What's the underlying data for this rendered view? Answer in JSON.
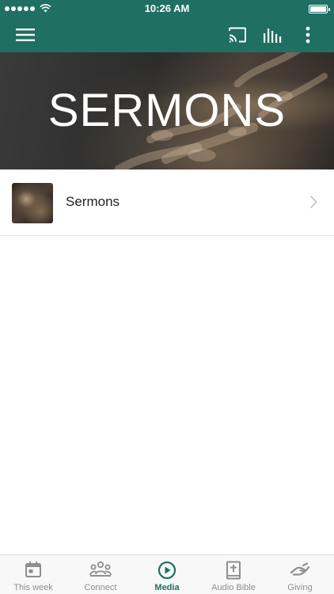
{
  "colors": {
    "brand": "#1f6f63",
    "tab_inactive": "#8e8e8e",
    "text": "#222222"
  },
  "status_bar": {
    "time": "10:26 AM",
    "signal_icon": "signal-dots-icon",
    "wifi_icon": "wifi-icon",
    "battery_icon": "battery-icon"
  },
  "app_bar": {
    "menu_icon": "hamburger-menu-icon",
    "cast_icon": "cast-icon",
    "audio_icon": "audio-bars-icon",
    "more_icon": "more-vertical-icon"
  },
  "hero": {
    "title": "SERMONS"
  },
  "list": {
    "items": [
      {
        "label": "Sermons",
        "icon": "chevron-right-icon"
      }
    ]
  },
  "tab_bar": {
    "tabs": [
      {
        "label": "This week",
        "icon": "calendar-icon",
        "active": false
      },
      {
        "label": "Connect",
        "icon": "people-icon",
        "active": false
      },
      {
        "label": "Media",
        "icon": "play-circle-icon",
        "active": true
      },
      {
        "label": "Audio Bible",
        "icon": "bible-icon",
        "active": false
      },
      {
        "label": "Giving",
        "icon": "giving-hand-icon",
        "active": false
      }
    ]
  }
}
